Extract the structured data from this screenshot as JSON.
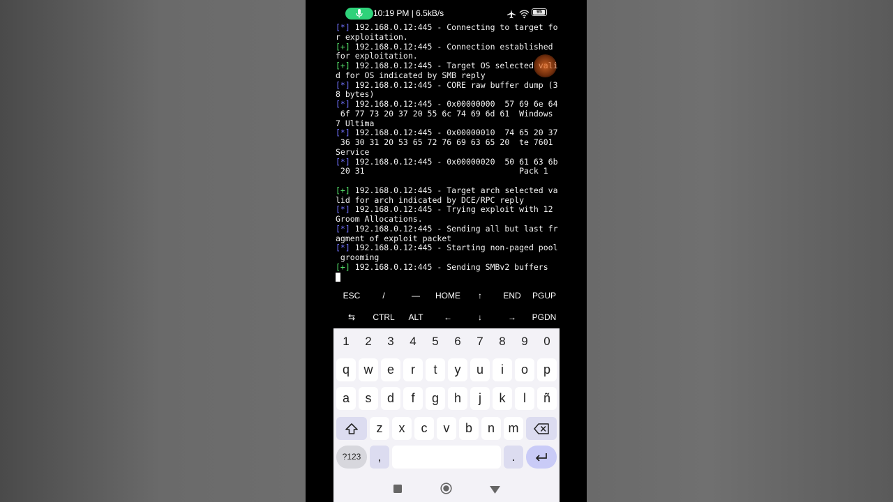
{
  "status_bar": {
    "time_speed": "10:19 PM | 6.5kB/s",
    "battery": "95",
    "icons": [
      "mic-icon",
      "airplane-icon",
      "wifi-icon",
      "battery-icon"
    ]
  },
  "terminal": {
    "lines": [
      {
        "tag": "[*]",
        "text": " 192.168.0.12:445 - Connecting to target fo"
      },
      {
        "tag": "",
        "text": "r exploitation."
      },
      {
        "tag": "[+]",
        "text": " 192.168.0.12:445 - Connection established"
      },
      {
        "tag": "",
        "text": "for exploitation."
      },
      {
        "tag": "[+]",
        "text": " 192.168.0.12:445 - Target OS selected vali"
      },
      {
        "tag": "",
        "text": "d for OS indicated by SMB reply"
      },
      {
        "tag": "[*]",
        "text": " 192.168.0.12:445 - CORE raw buffer dump (3"
      },
      {
        "tag": "",
        "text": "8 bytes)"
      },
      {
        "tag": "[*]",
        "text": " 192.168.0.12:445 - 0x00000000  57 69 6e 64"
      },
      {
        "tag": "",
        "text": " 6f 77 73 20 37 20 55 6c 74 69 6d 61  Windows"
      },
      {
        "tag": "",
        "text": "7 Ultima"
      },
      {
        "tag": "[*]",
        "text": " 192.168.0.12:445 - 0x00000010  74 65 20 37"
      },
      {
        "tag": "",
        "text": " 36 30 31 20 53 65 72 76 69 63 65 20  te 7601"
      },
      {
        "tag": "",
        "text": "Service"
      },
      {
        "tag": "[*]",
        "text": " 192.168.0.12:445 - 0x00000020  50 61 63 6b"
      },
      {
        "tag": "",
        "text": " 20 31                                Pack 1"
      },
      {
        "tag": "",
        "text": ""
      },
      {
        "tag": "[+]",
        "text": " 192.168.0.12:445 - Target arch selected va"
      },
      {
        "tag": "",
        "text": "lid for arch indicated by DCE/RPC reply"
      },
      {
        "tag": "[*]",
        "text": " 192.168.0.12:445 - Trying exploit with 12"
      },
      {
        "tag": "",
        "text": "Groom Allocations."
      },
      {
        "tag": "[*]",
        "text": " 192.168.0.12:445 - Sending all but last fr"
      },
      {
        "tag": "",
        "text": "agment of exploit packet"
      },
      {
        "tag": "[*]",
        "text": " 192.168.0.12:445 - Starting non-paged pool"
      },
      {
        "tag": "",
        "text": " grooming"
      },
      {
        "tag": "[+]",
        "text": " 192.168.0.12:445 - Sending SMBv2 buffers"
      }
    ]
  },
  "extra_keys": {
    "row1": [
      "ESC",
      "/",
      "—",
      "HOME",
      "↑",
      "END",
      "PGUP"
    ],
    "row2": [
      "⇆",
      "CTRL",
      "ALT",
      "←",
      "↓",
      "→",
      "PGDN"
    ]
  },
  "keyboard": {
    "numbers": [
      "1",
      "2",
      "3",
      "4",
      "5",
      "6",
      "7",
      "8",
      "9",
      "0"
    ],
    "row1": [
      "q",
      "w",
      "e",
      "r",
      "t",
      "y",
      "u",
      "i",
      "o",
      "p"
    ],
    "row2": [
      "a",
      "s",
      "d",
      "f",
      "g",
      "h",
      "j",
      "k",
      "l",
      "ñ"
    ],
    "row3": [
      "z",
      "x",
      "c",
      "v",
      "b",
      "n",
      "m"
    ],
    "mode_key": "?123",
    "comma": ",",
    "period": "."
  },
  "colors": {
    "info_tag": "#7272ff",
    "success_tag": "#56e36b",
    "mic_pill": "#2fd27a",
    "keyboard_bg": "#f3f2f7",
    "enter_key": "#c9cbf7"
  }
}
